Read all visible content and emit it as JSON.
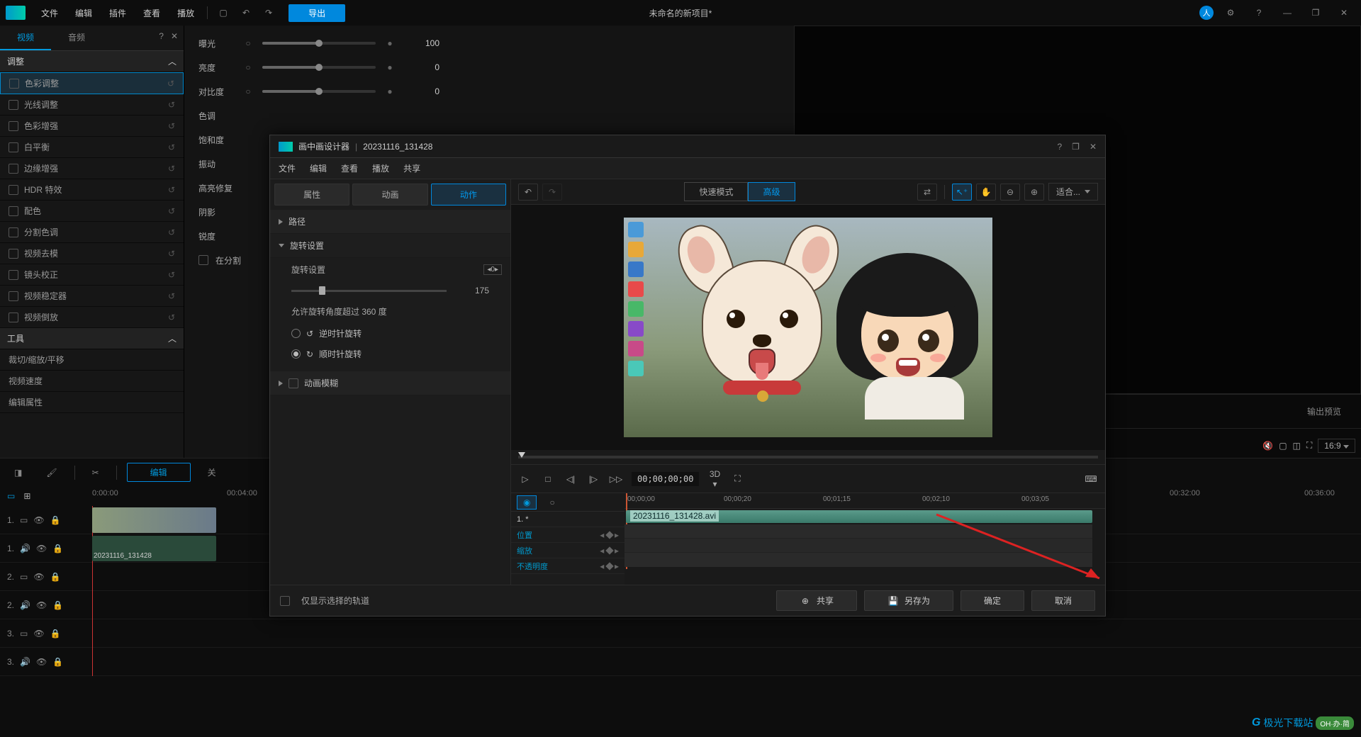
{
  "topbar": {
    "menus": [
      "文件",
      "编辑",
      "插件",
      "查看",
      "播放"
    ],
    "export": "导出",
    "project_title": "未命名的新项目*"
  },
  "leftPanel": {
    "tabs": {
      "video": "视频",
      "audio": "音频"
    },
    "adjustHeader": "调整",
    "adjustments": [
      "色彩调整",
      "光线调整",
      "色彩增强",
      "白平衡",
      "边缘增强",
      "HDR 特效",
      "配色",
      "分割色调",
      "视频去模",
      "镜头校正",
      "视频稳定器",
      "视频倒放"
    ],
    "toolsHeader": "工具",
    "tools": [
      "裁切/缩放/平移",
      "视频速度",
      "编辑属性"
    ]
  },
  "props": {
    "rows": [
      {
        "label": "曝光",
        "value": "100",
        "pos": 50
      },
      {
        "label": "亮度",
        "value": "0",
        "pos": 50
      },
      {
        "label": "对比度",
        "value": "0",
        "pos": 50
      },
      {
        "label": "色调",
        "value": "",
        "pos": null
      },
      {
        "label": "饱和度",
        "value": "",
        "pos": null
      },
      {
        "label": "振动",
        "value": "",
        "pos": null
      },
      {
        "label": "高亮修复",
        "value": "",
        "pos": null
      },
      {
        "label": "阴影",
        "value": "",
        "pos": null
      },
      {
        "label": "锐度",
        "value": "",
        "pos": null
      }
    ],
    "splitToning": "在分割"
  },
  "previewBottom": {
    "outputPreview": "输出预览",
    "aspect": "16:9"
  },
  "timelineToolbar": {
    "edit": "编辑",
    "close_btn": "关"
  },
  "timeRuler": [
    "0:00:00",
    "00:04:00",
    "00:32:00",
    "00:36:00"
  ],
  "tracks": {
    "clip_name": "20231116_131428",
    "labels": [
      "1.",
      "1.",
      "2.",
      "2.",
      "3.",
      "3."
    ]
  },
  "dialog": {
    "title": "画中画设计器",
    "clip": "20231116_131428",
    "menus": [
      "文件",
      "编辑",
      "查看",
      "播放",
      "共享"
    ],
    "leftTabs": {
      "props": "属性",
      "anim": "动画",
      "action": "动作"
    },
    "pathSection": "路径",
    "rotateSection": "旋转设置",
    "rotateLabel": "旋转设置",
    "rotateValue": "175",
    "allowOver360": "允许旋转角度超过 360 度",
    "ccw": "逆时针旋转",
    "cw": "顺时针旋转",
    "blurSection": "动画模糊",
    "modes": {
      "quick": "快速模式",
      "advanced": "高级"
    },
    "fit": "适合...",
    "timecode": "00;00;00;00",
    "threeD": "3D",
    "tlHeader": "1. *",
    "tlRuler": [
      "00;00;00",
      "00;00;20",
      "00;01;15",
      "00;02;10",
      "00;03;05"
    ],
    "tlClipName": "20231116_131428.avi",
    "tlTracks": [
      "位置",
      "缩放",
      "不透明度"
    ],
    "footer": {
      "onlySelected": "仅显示选择的轨道",
      "share": "共享",
      "saveAs": "另存为",
      "ok": "确定",
      "cancel": "取消"
    }
  },
  "watermark": {
    "site": "极光下载站",
    "badge": "OH·办·简"
  }
}
